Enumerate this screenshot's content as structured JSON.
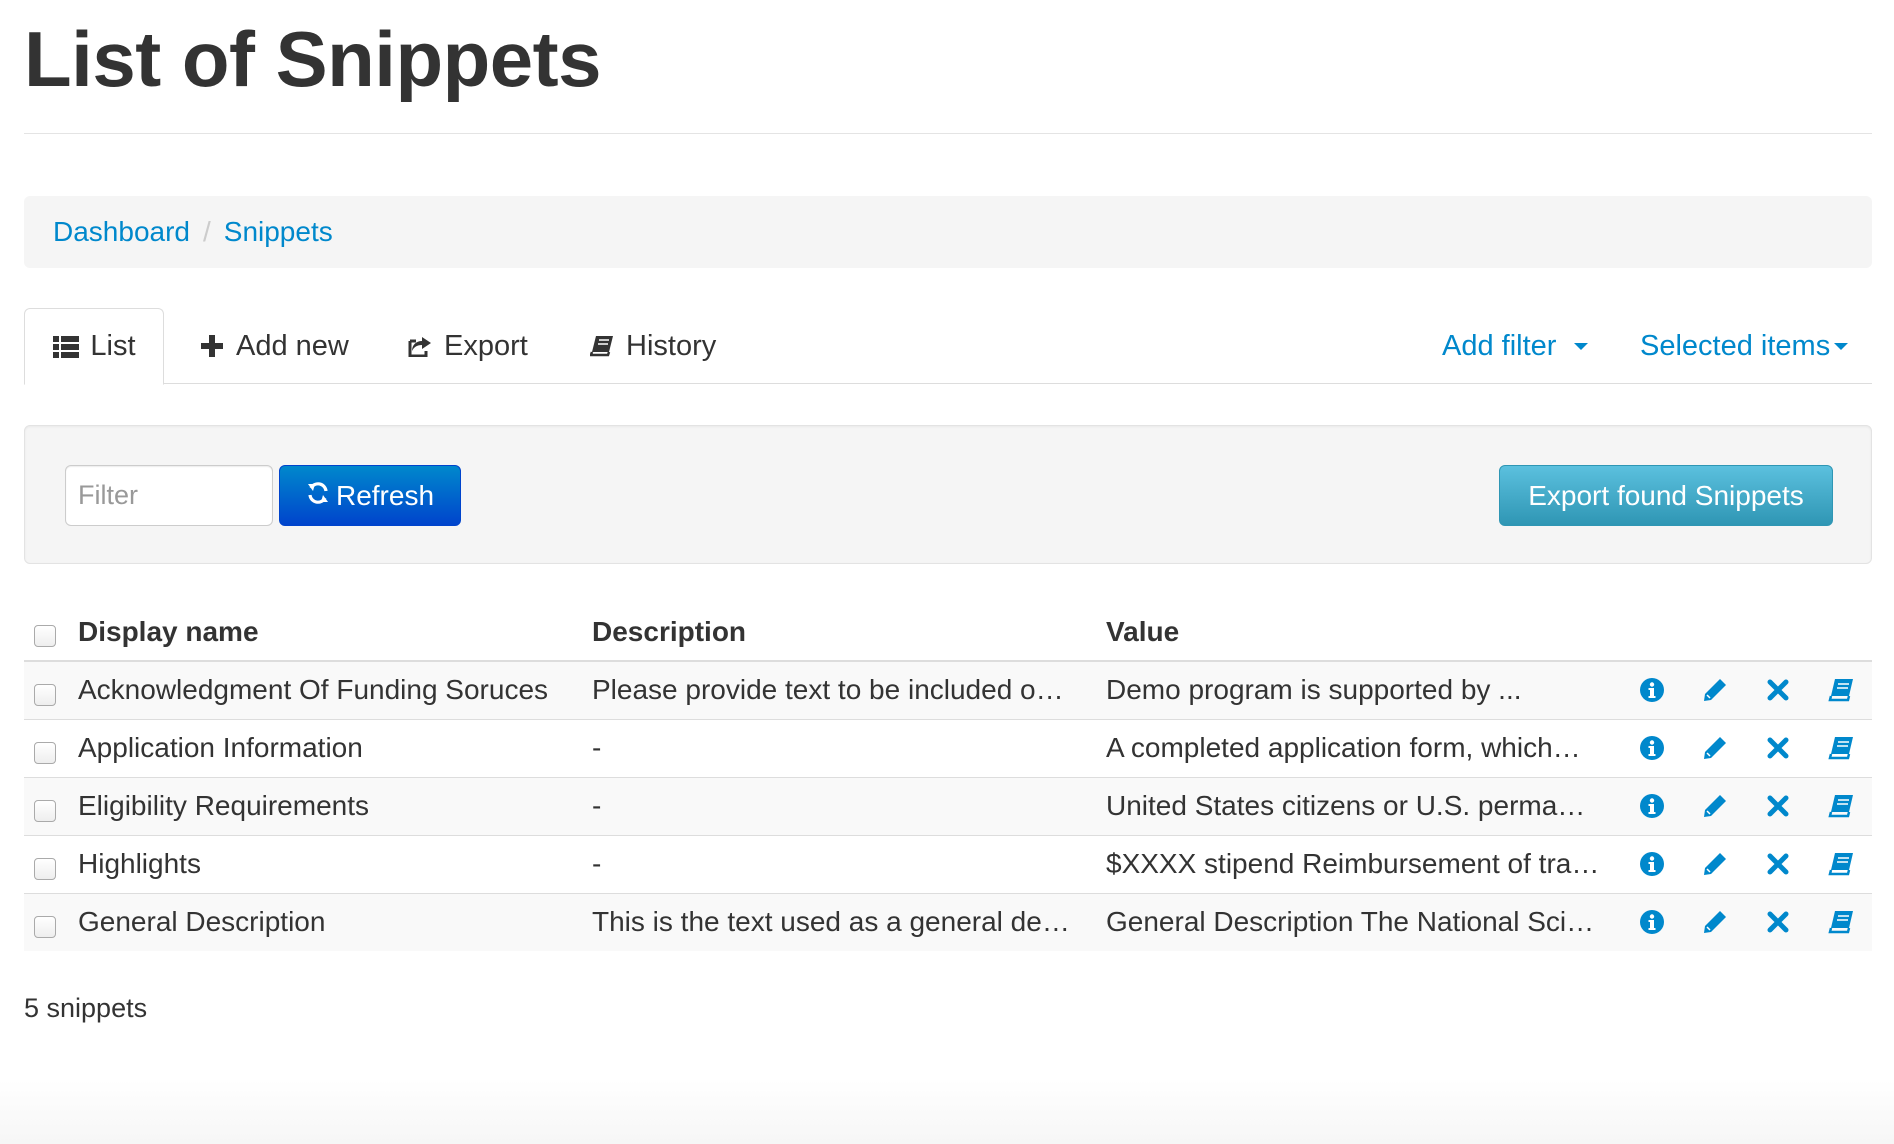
{
  "page": {
    "title": "List of Snippets"
  },
  "breadcrumb": {
    "items": [
      "Dashboard",
      "Snippets"
    ],
    "separator": "/"
  },
  "tabs": [
    {
      "label": "List",
      "icon": "list-icon",
      "active": true
    },
    {
      "label": "Add new",
      "icon": "plus-icon"
    },
    {
      "label": "Export",
      "icon": "share-icon"
    },
    {
      "label": "History",
      "icon": "book-icon"
    }
  ],
  "tabs_right": {
    "add_filter": "Add filter",
    "selected_items": "Selected items"
  },
  "toolbar": {
    "filter_placeholder": "Filter",
    "refresh_label": "Refresh",
    "export_label": "Export found Snippets"
  },
  "table": {
    "columns": [
      "Display name",
      "Description",
      "Value"
    ],
    "rows": [
      {
        "name": "Acknowledgment Of Funding Soruces",
        "description": "Please provide text to be included o…",
        "value": "Demo program is supported by ..."
      },
      {
        "name": "Application Information",
        "description": "-",
        "value": "A completed application form, which…"
      },
      {
        "name": "Eligibility Requirements",
        "description": "-",
        "value": "United States citizens or U.S. perma…"
      },
      {
        "name": "Highlights",
        "description": "-",
        "value": "$XXXX stipend Reimbursement of tra…"
      },
      {
        "name": "General Description",
        "description": "This is the text used as a general de…",
        "value": "General Description The National Sci…"
      }
    ],
    "row_actions": [
      "info-icon",
      "pencil-icon",
      "delete-icon",
      "book-icon"
    ]
  },
  "footer": {
    "count_text": "5 snippets"
  },
  "colors": {
    "link": "#0088cc",
    "primary": "#0044cc",
    "info": "#2f96b4"
  }
}
